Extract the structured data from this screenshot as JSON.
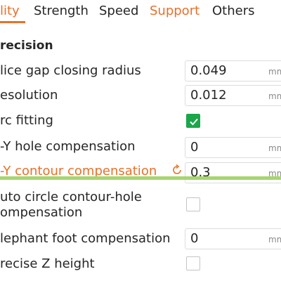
{
  "tabs": [
    {
      "label": "lity",
      "state": "active"
    },
    {
      "label": "Strength",
      "state": "normal"
    },
    {
      "label": "Speed",
      "state": "normal"
    },
    {
      "label": "Support",
      "state": "highlight"
    },
    {
      "label": "Others",
      "state": "normal"
    }
  ],
  "section": {
    "title": "recision"
  },
  "settings": [
    {
      "label": "lice gap closing radius",
      "value": "0.049",
      "unit": "mm"
    },
    {
      "label": "esolution",
      "value": "0.012",
      "unit": "mm"
    },
    {
      "label": "rc fitting",
      "checked": true
    },
    {
      "label": "-Y hole compensation",
      "value": "0",
      "unit": "mm"
    },
    {
      "label": "-Y contour compensation",
      "value": "0.3",
      "unit": "mm",
      "modified": true,
      "reset_icon": "reset-icon"
    },
    {
      "label": "uto circle contour-hole",
      "label_line2": "ompensation",
      "checked": false
    },
    {
      "label": "lephant foot compensation",
      "value": "0",
      "unit": "mm"
    },
    {
      "label": "recise Z height",
      "checked": false
    }
  ],
  "colors": {
    "accent": "#e8702a",
    "checked": "#1aa64a",
    "row_highlight": "#a6d66f"
  }
}
